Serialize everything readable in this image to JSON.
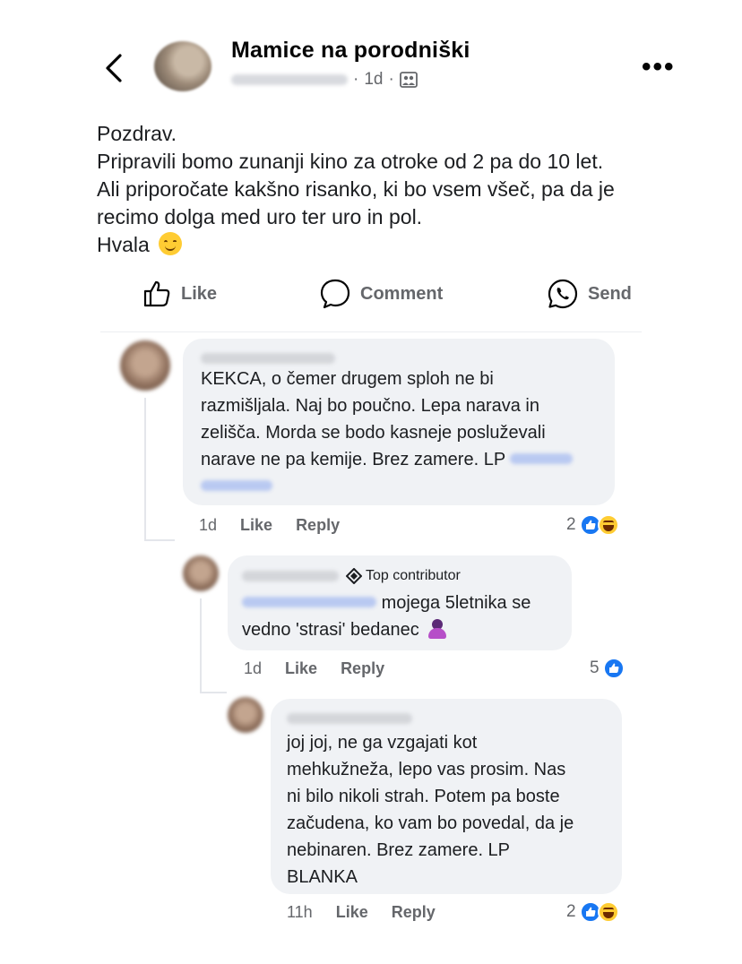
{
  "header": {
    "group_name": "Mamice na porodniški",
    "time": "1d",
    "separator": "·",
    "icons": {
      "back": "chevron-left-icon",
      "audience": "group-audience-icon",
      "more": "more-options-icon"
    },
    "more_label": "•••"
  },
  "post": {
    "lines": [
      "Pozdrav.",
      "Pripravili bomo zunanji kino za otroke od 2 pa do 10 let.",
      "Ali priporočate kakšno risanko, ki bo vsem všeč, pa da je",
      "recimo dolga med uro ter uro in pol.",
      "Hvala"
    ]
  },
  "actions": {
    "like": "Like",
    "comment": "Comment",
    "send": "Send"
  },
  "comments": [
    {
      "lines": [
        "KEKCA, o čemer drugem sploh ne bi",
        "razmišljala. Naj bo poučno. Lepa narava in",
        "zelišča. Morda se bodo kasneje posluževali",
        "narave ne pa kemije. Brez zamere. LP"
      ],
      "time": "1d",
      "like": "Like",
      "reply": "Reply",
      "reaction_count": "2",
      "reactions": [
        "like",
        "haha"
      ]
    },
    {
      "badge": "Top contributor",
      "lines": [
        "mojega 5letnika se",
        "vedno 'strasi' bedanec"
      ],
      "time": "1d",
      "like": "Like",
      "reply": "Reply",
      "reaction_count": "5",
      "reactions": [
        "like"
      ]
    },
    {
      "lines": [
        "joj joj, ne ga vzgajati kot",
        "mehkužneža, lepo vas prosim. Nas",
        "ni bilo nikoli strah. Potem pa boste",
        "začudena, ko vam bo povedal, da je",
        "nebinaren. Brez zamere. LP",
        "BLANKA"
      ],
      "time": "11h",
      "like": "Like",
      "reply": "Reply",
      "reaction_count": "2",
      "reactions": [
        "like",
        "haha"
      ]
    }
  ],
  "colors": {
    "text": "#050505",
    "secondary": "#65676b",
    "bubble": "#f0f2f5",
    "like_blue": "#1877f2"
  }
}
